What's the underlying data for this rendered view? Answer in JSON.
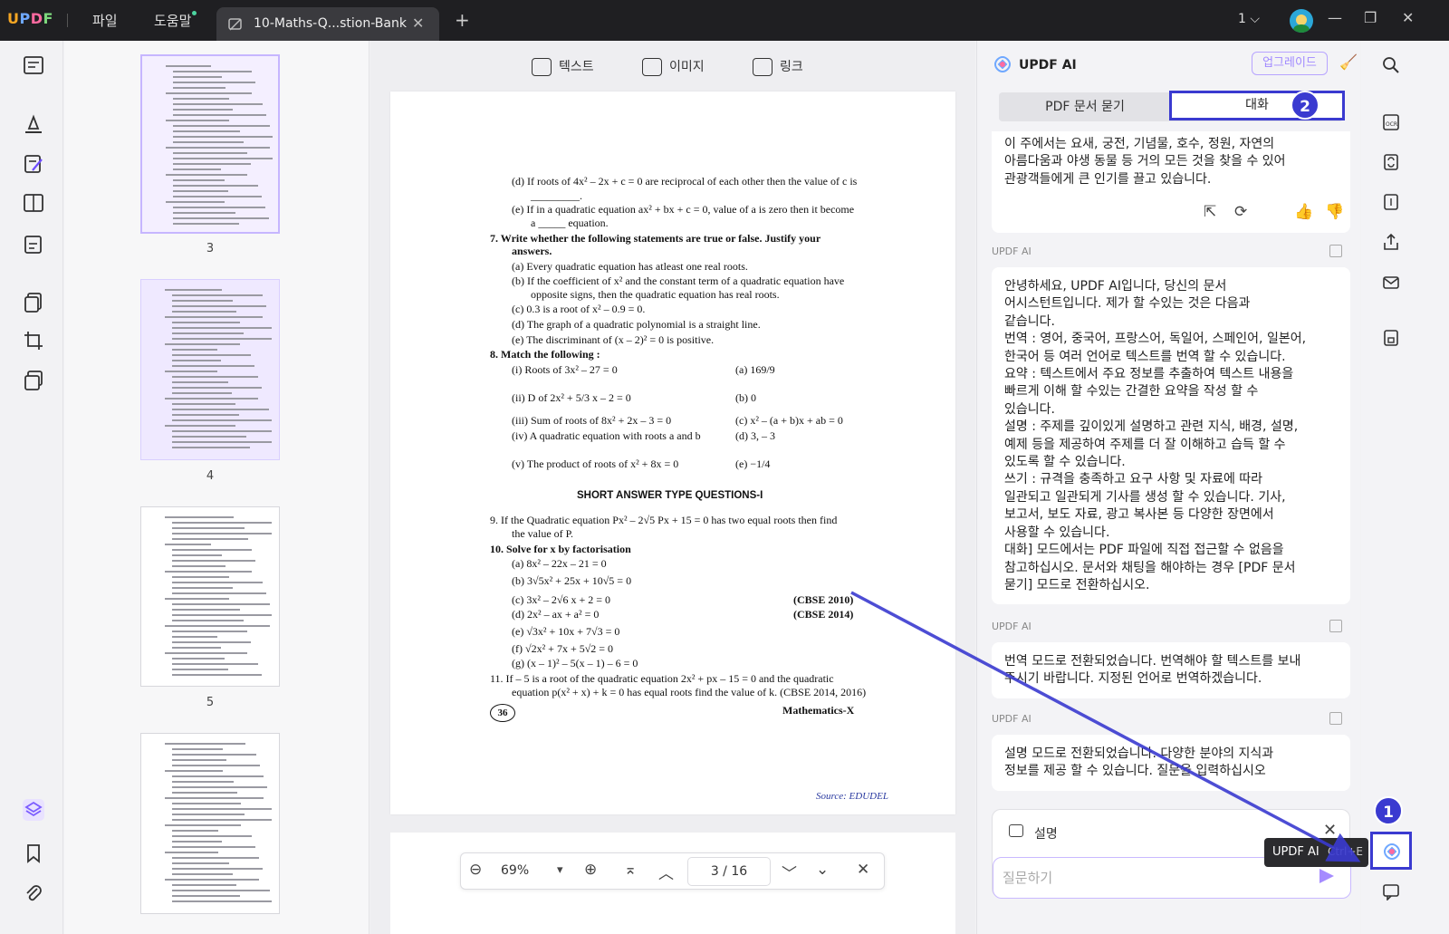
{
  "titlebar": {
    "logo": {
      "u": "U",
      "p": "P",
      "d": "D",
      "f": "F"
    },
    "menu_file": "파일",
    "menu_help": "도움말",
    "tab_title": "10-Maths-Q...stion-Bank",
    "tab_close": "✕",
    "tab_add": "+",
    "page_selector": "1 ⌵",
    "win_min": "—",
    "win_restore": "❐",
    "win_close": "✕"
  },
  "thumbnails": [
    {
      "label": "3"
    },
    {
      "label": "4"
    },
    {
      "label": "5"
    }
  ],
  "doc_toolbar": {
    "text": "텍스트",
    "image": "이미지",
    "link": "링크"
  },
  "document": {
    "lines": [
      "(d)  If roots of 4x² – 2x + c = 0 are reciprocal of each other then the value of c is",
      "_________.",
      "(e)  If in a quadratic equation ax² + bx + c = 0, value of a is zero then it become",
      "a _____ equation.",
      "7.   Write whether the following statements are true or false. Justify your",
      "answers.",
      "(a)  Every quadratic equation has atleast one real roots.",
      "(b)  If the coefficient of x² and the constant term of a quadratic equation have",
      "opposite signs, then the quadratic equation has real roots.",
      "(c)  0.3 is a root of x² – 0.9 = 0.",
      "(d)  The graph of a quadratic polynomial is a straight line.",
      "(e)  The discriminant of (x – 2)² = 0 is positive.",
      "8.   Match the following :",
      "(i)   Roots of 3x² – 27 = 0",
      "(a)  169/9",
      "(ii)  D of 2x² + 5/3 x – 2 = 0",
      "(b)  0",
      "(iii) Sum of roots of 8x² + 2x – 3 = 0",
      "(c)  x² – (a + b)x + ab = 0",
      "(iv)  A quadratic equation with roots a and b",
      "(d)  3, – 3",
      "(v)   The product of roots of x² + 8x = 0",
      "(e)  −1/4",
      "SHORT ANSWER TYPE QUESTIONS-I",
      "9.   If the Quadratic equation Px² – 2√5 Px + 15 = 0 has two equal roots then find",
      "the value of P.",
      "10.  Solve for x by factorisation",
      "(a)  8x² – 22x – 21 = 0",
      "(b)  3√5x² + 25x + 10√5 = 0",
      "(c)  3x² – 2√6 x + 2 = 0",
      "(CBSE 2010)",
      "(d)  2x² – ax + a² = 0",
      "(CBSE 2014)",
      "(e)  √3x² + 10x + 7√3 = 0",
      "(f)  √2x² + 7x + 5√2 = 0",
      "(g)  (x – 1)² – 5(x – 1) – 6 = 0",
      "11.  If – 5 is a root of the quadratic equation 2x² + px – 15 = 0 and the quadratic",
      "equation p(x² + x) + k = 0 has equal roots find the value of k.  (CBSE 2014, 2016)",
      "Mathematics-X"
    ],
    "page_number": "36",
    "source": "Source: EDUDEL"
  },
  "navbar": {
    "zoom_out": "⊖",
    "zoom": "69%",
    "zoom_dropdown": "▾",
    "zoom_in": "⊕",
    "first": "⌅",
    "prev": "︿",
    "page": "3  /  16",
    "next": "﹀",
    "last": "⌄",
    "close": "✕"
  },
  "ai": {
    "title": "UPDF AI",
    "upgrade": "업그레이드",
    "tab_pdf": "PDF 문서 묻기",
    "tab_chat": "대화",
    "badge_2": "2",
    "badge_1": "1",
    "msg0_lines": [
      "이 주에서는 요새, 궁전, 기념물, 호수, 정원, 자연의",
      "아름다움과 야생 동물 등 거의 모든 것을 찾을 수 있어",
      "관광객들에게 큰 인기를 끌고 있습니다."
    ],
    "sender": "UPDF AI",
    "msg1_lines": [
      "안녕하세요, UPDF AI입니다, 당신의 문서",
      "어시스턴트입니다. 제가 할 수있는 것은 다음과",
      "같습니다.",
      "번역 : 영어, 중국어, 프랑스어, 독일어, 스페인어, 일본어,",
      "한국어 등 여러 언어로 텍스트를 번역 할 수 있습니다.",
      "요약 : 텍스트에서 주요 정보를 추출하여 텍스트 내용을",
      "빠르게 이해 할 수있는 간결한 요약을 작성 할 수",
      "있습니다.",
      "설명 : 주제를 깊이있게 설명하고 관련 지식, 배경, 설명,",
      "예제 등을 제공하여 주제를 더 잘 이해하고 습득 할 수",
      "있도록 할 수 있습니다.",
      "쓰기 : 규격을 충족하고 요구 사항 및 자료에 따라",
      "일관되고 일관되게 기사를 생성 할 수 있습니다. 기사,",
      "보고서, 보도 자료, 광고 복사본 등 다양한 장면에서",
      "사용할 수 있습니다.",
      "대화] 모드에서는 PDF 파일에 직접 접근할 수 없음을",
      "참고하십시오. 문서와 채팅을 해야하는 경우 [PDF 문서",
      "묻기] 모드로 전환하십시오."
    ],
    "msg2_lines": [
      "번역 모드로 전환되었습니다. 번역해야 할 텍스트를 보내",
      "주시기 바랍니다. 지정된 언어로 번역하겠습니다."
    ],
    "msg3_lines": [
      "설명 모드로 전환되었습니다. 다양한 분야의 지식과",
      "정보를 제공 할 수 있습니다. 질문을 입력하십시오"
    ],
    "mode_label": "설명",
    "mode_close": "✕",
    "input_placeholder": "질문하기",
    "tooltip_name": "UPDF AI",
    "tooltip_shortcut": "Ctrl+E"
  },
  "colors": {
    "accent": "#3a3ad0",
    "ai_purple": "#a58bff",
    "titlebar": "#1f1f22"
  }
}
